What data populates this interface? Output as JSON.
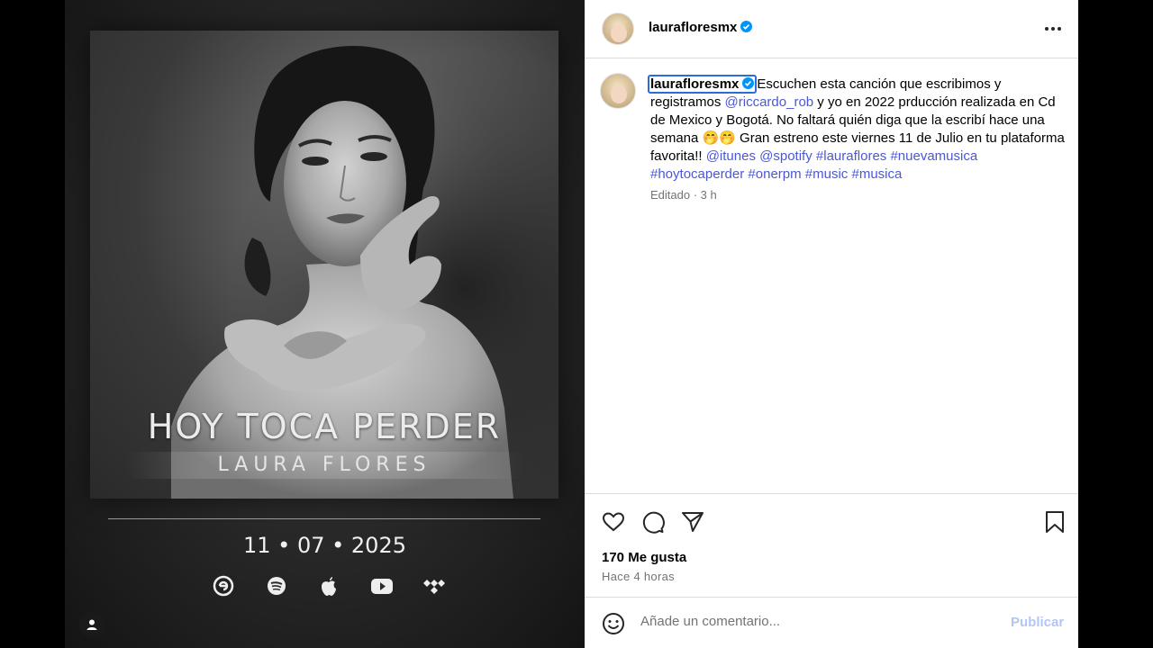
{
  "media": {
    "cover_title": "HOY TOCA PERDER",
    "cover_artist": "LAURA FLORES",
    "release_date": "11 • 07 • 2025",
    "platform_icons": [
      "claro-music-icon",
      "spotify-icon",
      "apple-icon",
      "youtube-icon",
      "tidal-icon"
    ],
    "tag_icon": "user-tag-icon"
  },
  "post": {
    "header": {
      "username": "laurafloresmx",
      "verified": true,
      "more_icon": "more-options-icon"
    },
    "caption": {
      "username": "laurafloresmx",
      "text_1": "Escuchen esta canción que escribimos y registramos ",
      "mention_1": "@riccardo_rob",
      "text_2": " y yo en 2022 prducción realizada en Cd de Mexico y Bogotá. No faltará quién diga que la escribí hace una semana 🤭🤭 Gran estreno este viernes 11 de Julio en tu plataforma favorita!! ",
      "mention_2": "@itunes",
      "mention_3": "@spotify",
      "hashtag_1": "#lauraflores",
      "hashtag_2": "#nuevamusica",
      "hashtag_3": "#hoytocaperder",
      "hashtag_4": "#onerpm",
      "hashtag_5": "#music",
      "hashtag_6": "#musica",
      "meta": "Editado · 3 h"
    },
    "actions": {
      "likes": "170 Me gusta",
      "time": "Hace 4 horas"
    },
    "comment": {
      "placeholder": "Añade un comentario...",
      "publish_label": "Publicar"
    }
  },
  "colors": {
    "link": "#4a58d6",
    "verified": "#0095f6",
    "publish_disabled": "#b3c7f5"
  }
}
